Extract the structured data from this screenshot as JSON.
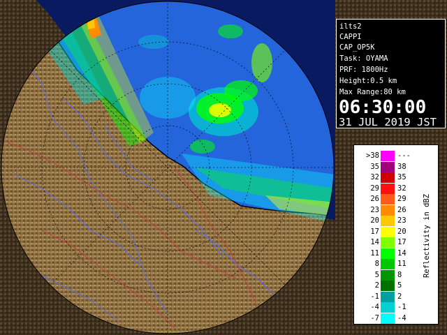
{
  "radar": {
    "site": "ilts2",
    "product": "CAPPI",
    "product_code": "CAP_OP5K",
    "task": "Task: OYAMA",
    "prf": "PRF: 1800Hz",
    "height": "Height:0.5 km",
    "max_range": "Max Range:80 km",
    "time": "06:30:00",
    "date": "31 JUL 2019 JST"
  },
  "legend": {
    "title": "Reflectivity in dBZ",
    "rows": [
      {
        "left": ">38",
        "right": "---",
        "color": "#ff00ff"
      },
      {
        "left": "35",
        "right": "38",
        "color": "#a0007a"
      },
      {
        "left": "32",
        "right": "35",
        "color": "#d00000"
      },
      {
        "left": "29",
        "right": "32",
        "color": "#ff1010"
      },
      {
        "left": "26",
        "right": "29",
        "color": "#ff5a1a"
      },
      {
        "left": "23",
        "right": "26",
        "color": "#ff8c00"
      },
      {
        "left": "20",
        "right": "23",
        "color": "#ffc800"
      },
      {
        "left": "17",
        "right": "20",
        "color": "#ffff00"
      },
      {
        "left": "14",
        "right": "17",
        "color": "#80ff00"
      },
      {
        "left": "11",
        "right": "14",
        "color": "#00ff00"
      },
      {
        "left": "8",
        "right": "11",
        "color": "#00c800"
      },
      {
        "left": "5",
        "right": "8",
        "color": "#009600"
      },
      {
        "left": "2",
        "right": "5",
        "color": "#007000"
      },
      {
        "left": "-1",
        "right": "2",
        "color": "#00a0a0"
      },
      {
        "left": "-4",
        "right": "-1",
        "color": "#00d2d2"
      },
      {
        "left": "-7",
        "right": "-4",
        "color": "#00ffff"
      }
    ]
  },
  "colors": {
    "ocean": "#2565dc",
    "ocean_far": "#1e3fd0",
    "land": "#8b6a3e",
    "rivers": "#5a6ee6",
    "boundaries": "#c04040",
    "range_rings": "#000000"
  }
}
